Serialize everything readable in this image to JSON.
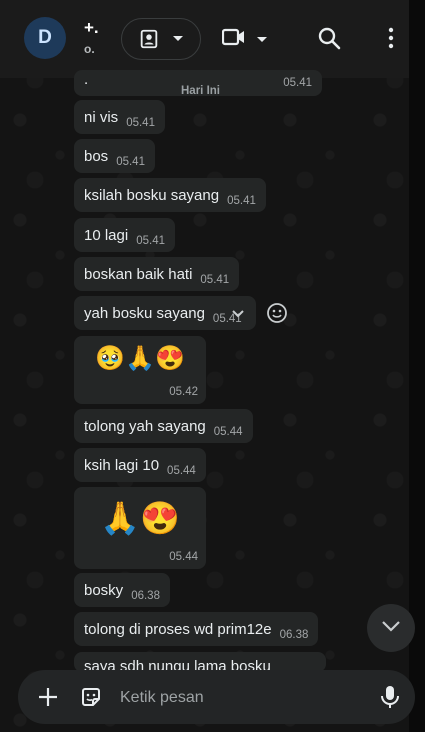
{
  "header": {
    "avatar_initial": "D",
    "title": "+.",
    "subtitle": "o."
  },
  "date_chip": "Hari Ini",
  "messages": [
    {
      "text": ".",
      "time": "05.41"
    },
    {
      "text": "ni vis",
      "time": "05.41"
    },
    {
      "text": "bos",
      "time": "05.41"
    },
    {
      "text": "ksilah bosku sayang",
      "time": "05.41"
    },
    {
      "text": "10 lagi",
      "time": "05.41"
    },
    {
      "text": "boskan baik hati",
      "time": "05.41"
    },
    {
      "text": "yah bosku sayang",
      "time": "05.41"
    },
    {
      "emoji": "🥹🙏😍",
      "time": "05.42"
    },
    {
      "text": "tolong yah sayang",
      "time": "05.44"
    },
    {
      "text": "ksih lagi 10",
      "time": "05.44"
    },
    {
      "emoji": "🙏😍",
      "time": "05.44"
    },
    {
      "text": "bosky",
      "time": "06.38"
    },
    {
      "text": "tolong di proses wd prim12e",
      "time": "06.38"
    },
    {
      "text": "saya sdh nungu lama bosku",
      "time": ""
    }
  ],
  "composer": {
    "placeholder": "Ketik pesan"
  },
  "icons": {
    "call": "call-icon",
    "video": "video-icon",
    "search": "search-icon",
    "menu": "more-vert-icon",
    "emoji_react": "emoji-icon",
    "scroll": "chevron-down-icon",
    "plus": "plus-icon",
    "sticker": "sticker-icon",
    "mic": "mic-icon"
  },
  "colors": {
    "bubble": "#242626",
    "header": "#1b1b1b",
    "accent": "#00a884"
  }
}
